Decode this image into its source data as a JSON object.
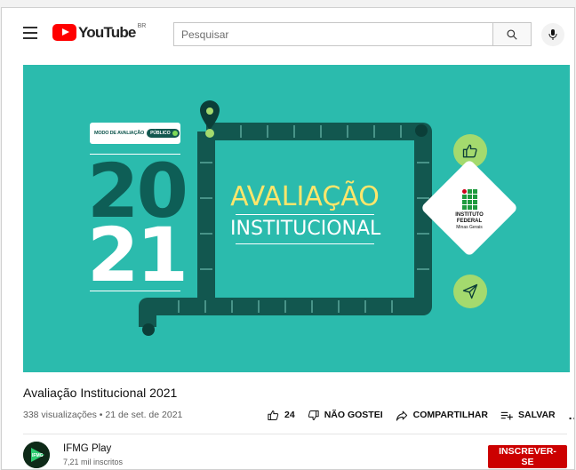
{
  "header": {
    "logo_text": "YouTube",
    "region": "BR",
    "search_placeholder": "Pesquisar"
  },
  "thumbnail": {
    "tag_label": "MODO DE AVALIAÇÃO",
    "tag_badge": "PÚBLICO",
    "year_top": "20",
    "year_bottom": "21",
    "title_line1": "AVALIAÇÃO",
    "title_line2": "INSTITUCIONAL",
    "institution_line1": "INSTITUTO",
    "institution_line2": "FEDERAL",
    "institution_line3": "Minas Gerais",
    "colors": {
      "background": "#2bbbad",
      "track": "#12574f",
      "accent": "#a4da6e",
      "title": "#ffe66b"
    }
  },
  "video": {
    "title": "Avaliação Institucional 2021",
    "meta": "338 visualizações • 21 de set. de 2021",
    "likes": "24",
    "dislike_label": "NÃO GOSTEI",
    "share_label": "COMPARTILHAR",
    "save_label": "SALVAR",
    "more_label": "..."
  },
  "channel": {
    "name": "IFMG Play",
    "subscribers": "7,21 mil inscritos",
    "avatar_text": "IFMG",
    "subscribe_label": "INSCREVER-SE"
  }
}
